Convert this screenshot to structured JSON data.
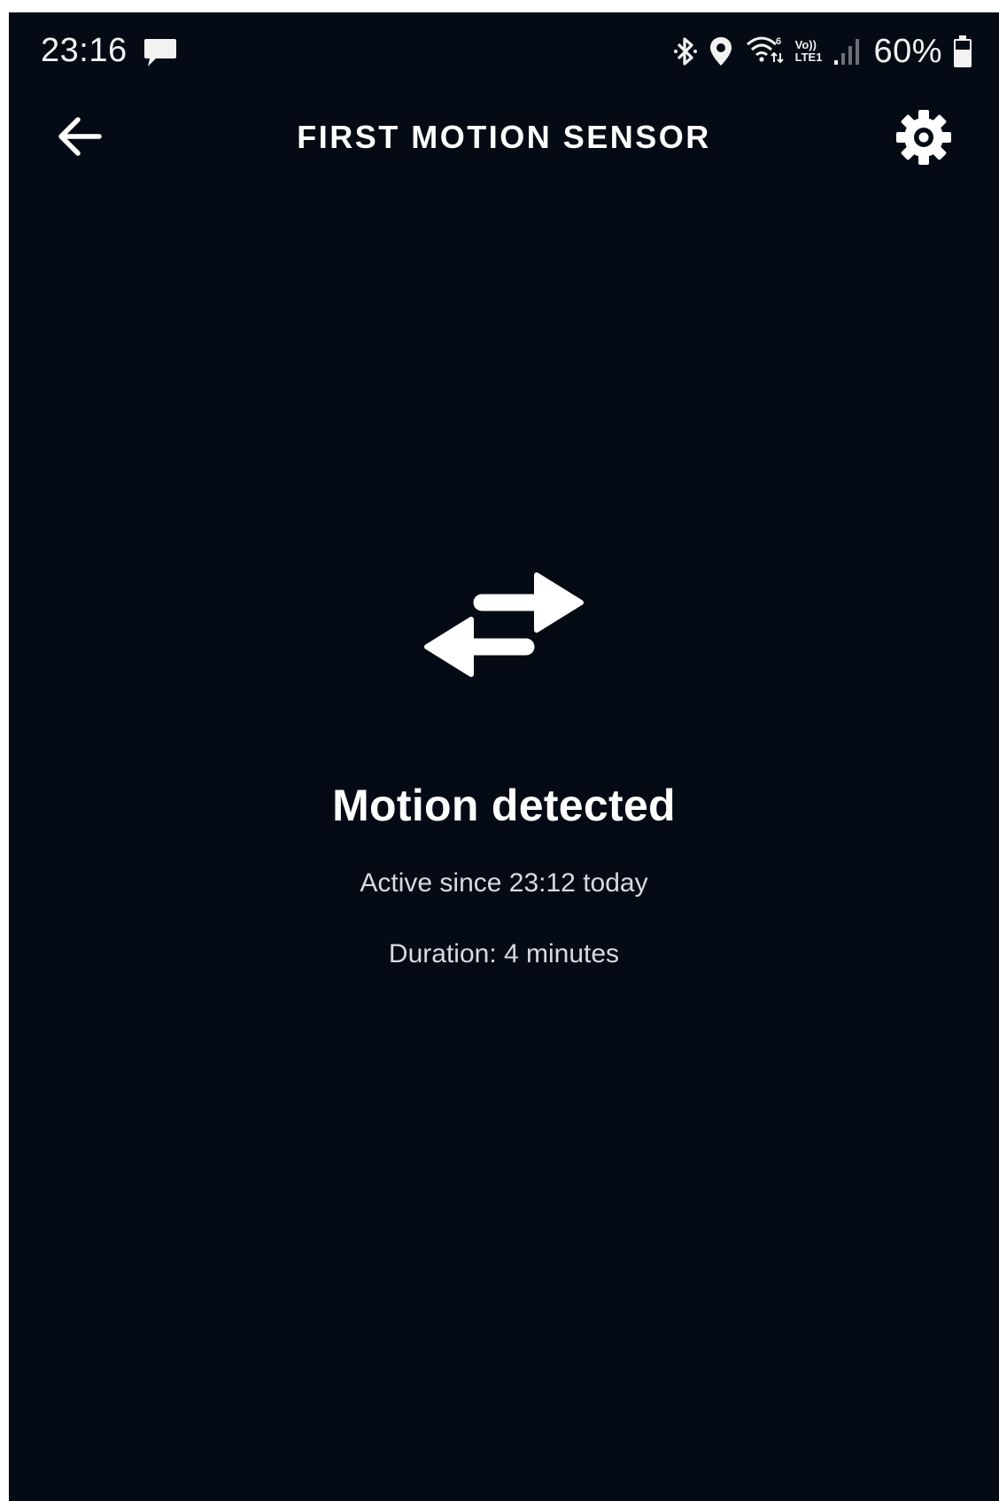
{
  "status_bar": {
    "time": "23:16",
    "network_label_top": "Vo))",
    "network_label_bottom": "LTE1",
    "battery_percent": "60%",
    "icons": [
      "message-icon",
      "bluetooth-icon",
      "location-icon",
      "wifi-icon",
      "signal-icon",
      "battery-icon"
    ]
  },
  "header": {
    "title": "FIRST MOTION SENSOR",
    "back_icon": "arrow-left-icon",
    "settings_icon": "gear-icon"
  },
  "sensor": {
    "icon": "swap-arrows-icon",
    "status": "Motion detected",
    "active_since": "Active since 23:12 today",
    "duration": "Duration: 4 minutes"
  },
  "colors": {
    "background": "#050b14",
    "text_primary": "#ffffff",
    "text_secondary": "#d7dadf"
  }
}
